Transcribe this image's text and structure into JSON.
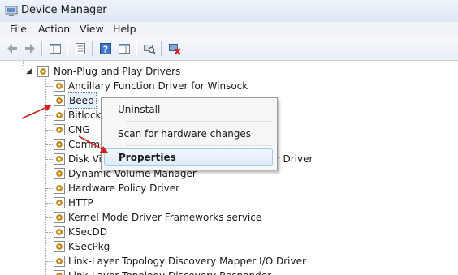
{
  "window": {
    "title": "Device Manager"
  },
  "menu": [
    "File",
    "Action",
    "View",
    "Help"
  ],
  "toolbar": {
    "buttons": [
      "back-arrow-icon",
      "forward-arrow-icon",
      "console-tree-icon",
      "properties-sheet-icon",
      "help-icon",
      "view-pane-icon",
      "scan-hardware-icon",
      "uninstall-device-icon"
    ]
  },
  "tree": {
    "category": "Non-Plug and Play Drivers",
    "items": [
      "Ancillary Function Driver for Winsock",
      "Beep",
      "Bitlocker Drive Encryption Filter Driver",
      "CNG",
      "Common Log (CLFS)",
      "Disk Virtual Machine Bus Acceleration Filter Driver",
      "Dynamic Volume Manager",
      "Hardware Policy Driver",
      "HTTP",
      "Kernel Mode Driver Frameworks service",
      "KSecDD",
      "KSecPkg",
      "Link-Layer Topology Discovery Mapper I/O Driver",
      "Link-Layer Topology Discovery Responder"
    ]
  },
  "context_menu": {
    "items": [
      "Uninstall",
      "Scan for hardware changes",
      "Properties"
    ]
  },
  "colors": {
    "annotation_arrow": "#d42020",
    "menu_hover": "#dcebfc"
  }
}
